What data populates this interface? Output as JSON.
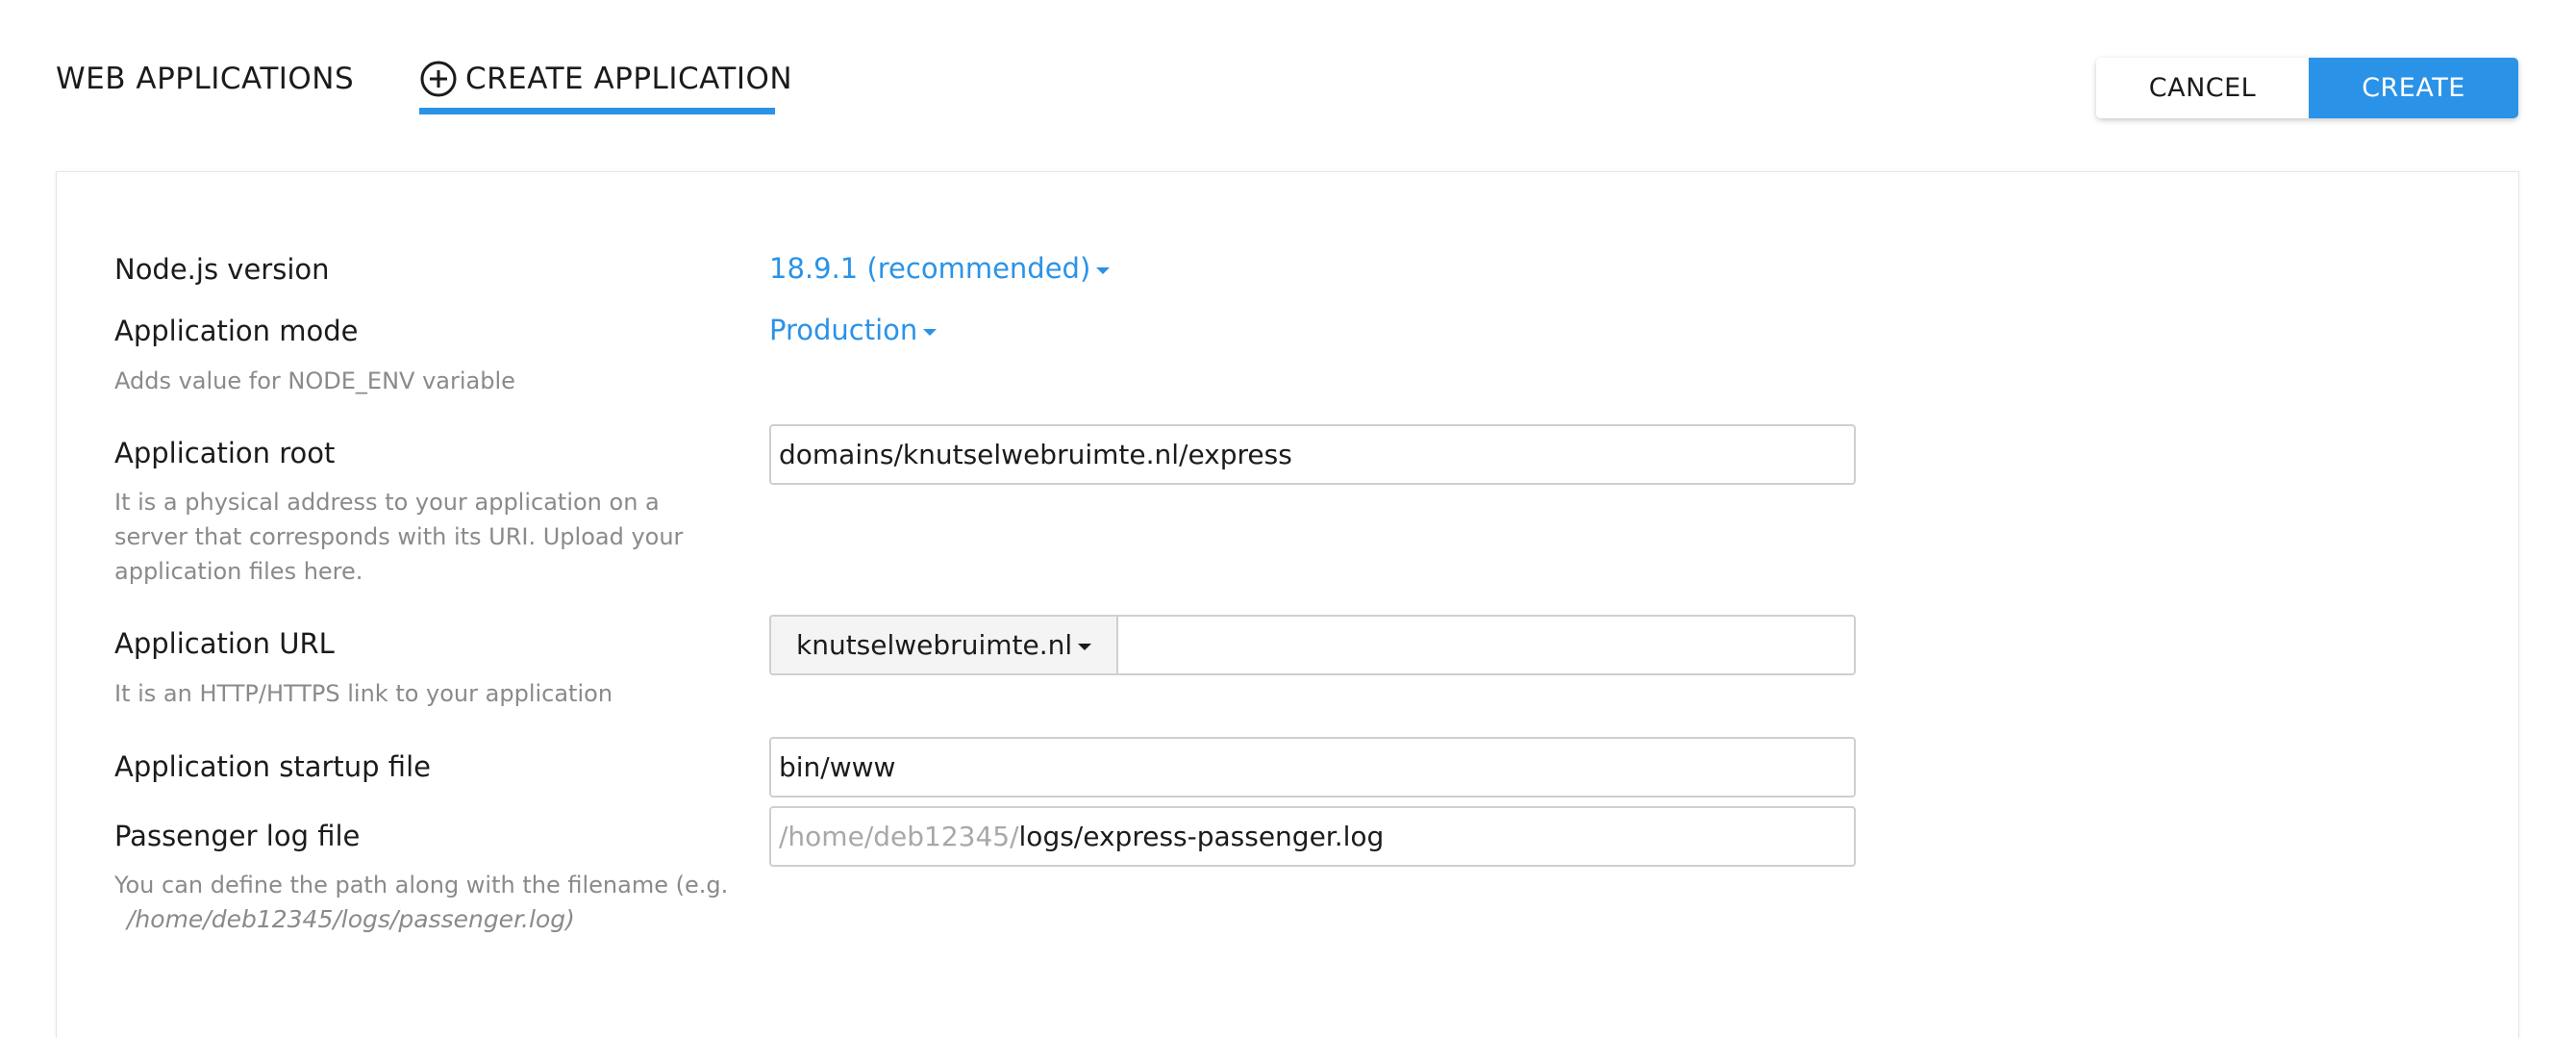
{
  "tabs": {
    "web_applications": "WEB APPLICATIONS",
    "create_application": "CREATE APPLICATION"
  },
  "buttons": {
    "cancel": "CANCEL",
    "create": "CREATE"
  },
  "colors": {
    "accent": "#2a93e8",
    "hint_text": "#8a8a8a"
  },
  "form": {
    "nodejs_version": {
      "label": "Node.js version",
      "value": "18.9.1 (recommended)"
    },
    "app_mode": {
      "label": "Application mode",
      "hint": "Adds value for NODE_ENV variable",
      "value": "Production"
    },
    "app_root": {
      "label": "Application root",
      "hint": "It is a physical address to your application on a server that corresponds with its URI. Upload your application files here.",
      "value": "domains/knutselwebruimte.nl/express"
    },
    "app_url": {
      "label": "Application URL",
      "hint": "It is an HTTP/HTTPS link to your application",
      "domain": "knutselwebruimte.nl",
      "path": ""
    },
    "startup_file": {
      "label": "Application startup file",
      "value": "bin/www"
    },
    "log_file": {
      "label": "Passenger log file",
      "hint": "You can define the path along with the filename (e.g.",
      "hint_example": "/home/deb12345/logs/passenger.log)",
      "prefix": "/home/deb12345/",
      "value": "logs/express-passenger.log"
    }
  },
  "icons": {
    "create_tab_icon": "plus-circle-icon",
    "dropdown_icon": "caret-down-icon"
  }
}
